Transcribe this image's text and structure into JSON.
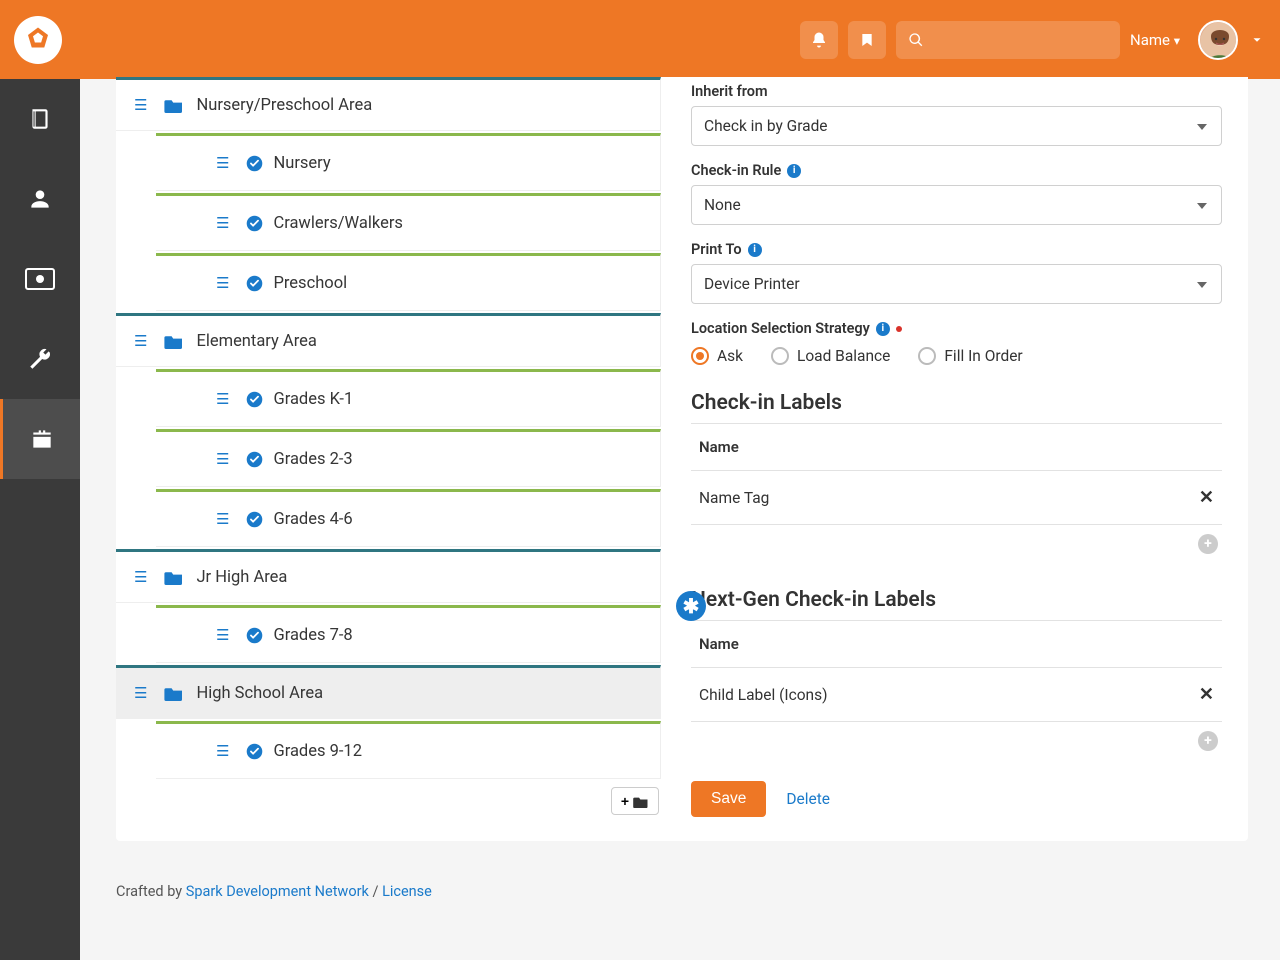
{
  "header": {
    "name_label": "Name"
  },
  "tree": [
    {
      "type": "area",
      "label": "Nursery/Preschool Area",
      "sel": false
    },
    {
      "type": "group",
      "label": "Nursery"
    },
    {
      "type": "group",
      "label": "Crawlers/Walkers"
    },
    {
      "type": "group",
      "label": "Preschool"
    },
    {
      "type": "area",
      "label": "Elementary Area",
      "sel": false
    },
    {
      "type": "group",
      "label": "Grades K-1"
    },
    {
      "type": "group",
      "label": "Grades 2-3"
    },
    {
      "type": "group",
      "label": "Grades 4-6"
    },
    {
      "type": "area",
      "label": "Jr High Area",
      "sel": false
    },
    {
      "type": "group",
      "label": "Grades 7-8"
    },
    {
      "type": "area",
      "label": "High School Area",
      "sel": true
    },
    {
      "type": "group",
      "label": "Grades 9-12"
    }
  ],
  "form": {
    "inherit_label": "Inherit from",
    "inherit_value": "Check in by Grade",
    "rule_label": "Check-in Rule",
    "rule_value": "None",
    "print_label": "Print To",
    "print_value": "Device Printer",
    "loc_label": "Location Selection Strategy",
    "loc_options": [
      "Ask",
      "Load Balance",
      "Fill In Order"
    ],
    "loc_selected": "Ask"
  },
  "labels_section": {
    "heading": "Check-in Labels",
    "col": "Name",
    "rows": [
      "Name Tag"
    ]
  },
  "labels_ng": {
    "heading": "Next-Gen Check-in Labels",
    "col": "Name",
    "rows": [
      "Child Label (Icons)"
    ]
  },
  "buttons": {
    "save": "Save",
    "delete": "Delete"
  },
  "footer": {
    "crafted": "Crafted by ",
    "sdn": "Spark Development Network",
    "sep": " / ",
    "license": "License"
  }
}
